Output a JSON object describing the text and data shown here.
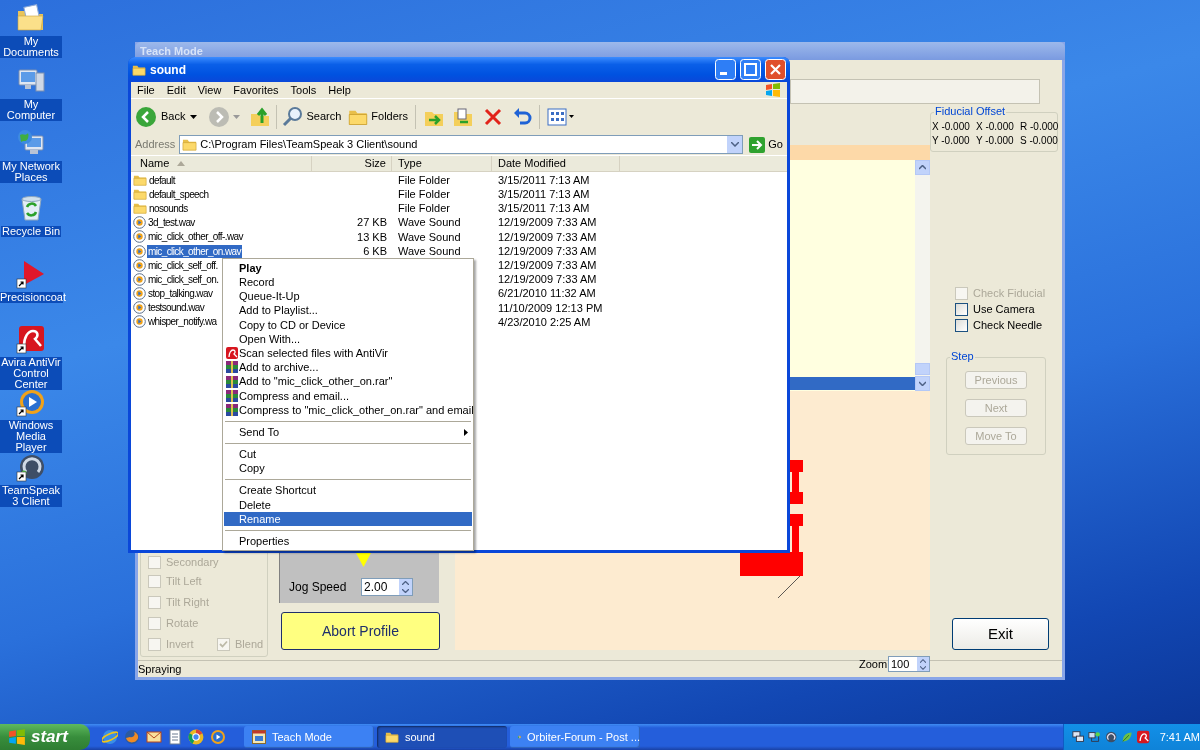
{
  "desktop_icons": [
    {
      "label": "My Documents",
      "kind": "documents",
      "shortcut": false
    },
    {
      "label": "My Computer",
      "kind": "computer",
      "shortcut": false
    },
    {
      "label": "My Network Places",
      "kind": "network",
      "shortcut": false
    },
    {
      "label": "Recycle Bin",
      "kind": "recycle",
      "shortcut": false
    },
    {
      "label": "Precisioncoat",
      "kind": "triangle",
      "shortcut": true
    },
    {
      "label": "Avira AntiVir Control Center",
      "kind": "umbrella",
      "shortcut": true
    },
    {
      "label": "Windows Media Player",
      "kind": "media",
      "shortcut": true
    },
    {
      "label": "TeamSpeak 3 Client",
      "kind": "headset",
      "shortcut": true
    }
  ],
  "teach_mode": {
    "title": "Teach Mode",
    "fiducial_offset": {
      "title": "Fiducial Offset",
      "rows": [
        [
          "X -0.000",
          "X -0.000",
          "R -0.000"
        ],
        [
          "Y -0.000",
          "Y -0.000",
          "S -0.000"
        ]
      ]
    },
    "program_list": {
      "rows": [
        {
          "selected": true
        }
      ]
    },
    "options": [
      {
        "label": "Check Fiducial",
        "checked": false,
        "disabled": true
      },
      {
        "label": "Use Camera",
        "checked": false,
        "disabled": false
      },
      {
        "label": "Check Needle",
        "checked": false,
        "disabled": false
      }
    ],
    "step": {
      "title": "Step",
      "buttons": [
        {
          "label": "Previous",
          "disabled": true
        },
        {
          "label": "Next",
          "disabled": true
        },
        {
          "label": "Move To",
          "disabled": true
        }
      ]
    },
    "exit_button": "Exit",
    "motion_options": [
      {
        "label": "Secondary",
        "checked": false,
        "disabled": true
      },
      {
        "label": "Tilt Left",
        "checked": false,
        "disabled": true
      },
      {
        "label": "Tilt Right",
        "checked": false,
        "disabled": true
      },
      {
        "label": "Rotate",
        "checked": false,
        "disabled": true
      },
      {
        "label": "Invert",
        "checked": false,
        "disabled": true
      },
      {
        "label": "Blend",
        "checked": true,
        "disabled": true
      }
    ],
    "jog_speed": {
      "label": "Jog Speed",
      "value": "2.00"
    },
    "abort_button": "Abort Profile",
    "status": "Spraying",
    "zoom": {
      "label": "Zoom",
      "value": "100"
    }
  },
  "explorer": {
    "title": "sound",
    "menu": [
      "File",
      "Edit",
      "View",
      "Favorites",
      "Tools",
      "Help"
    ],
    "toolbar": {
      "back": "Back",
      "search": "Search",
      "folders": "Folders"
    },
    "address": {
      "label": "Address",
      "value": "C:\\Program Files\\TeamSpeak 3 Client\\sound",
      "go": "Go"
    },
    "columns": [
      {
        "label": "Name",
        "sorted": true
      },
      {
        "label": "Size",
        "sorted": false
      },
      {
        "label": "Type",
        "sorted": false
      },
      {
        "label": "Date Modified",
        "sorted": false
      }
    ],
    "files": [
      {
        "kind": "folder",
        "name": "default",
        "type": "File Folder",
        "date": "3/15/2011 7:13 AM",
        "selected": false
      },
      {
        "kind": "folder",
        "name": "default_speech",
        "type": "File Folder",
        "date": "3/15/2011 7:13 AM",
        "selected": false
      },
      {
        "kind": "folder",
        "name": "nosounds",
        "type": "File Folder",
        "date": "3/15/2011 7:13 AM",
        "selected": false
      },
      {
        "kind": "sound",
        "name": "3d_test.wav",
        "size": "27 KB",
        "type": "Wave Sound",
        "date": "12/19/2009 7:33 AM",
        "selected": false
      },
      {
        "kind": "sound",
        "name": "mic_click_other_off-.wav",
        "size": "13 KB",
        "type": "Wave Sound",
        "date": "12/19/2009 7:33 AM",
        "selected": false
      },
      {
        "kind": "sound",
        "name": "mic_click_other_on.wav",
        "size": "6 KB",
        "type": "Wave Sound",
        "date": "12/19/2009 7:33 AM",
        "selected": true
      },
      {
        "kind": "sound",
        "name": "mic_click_self_off.",
        "date": "12/19/2009 7:33 AM",
        "selected": false
      },
      {
        "kind": "sound",
        "name": "mic_click_self_on.",
        "date": "12/19/2009 7:33 AM",
        "selected": false
      },
      {
        "kind": "sound",
        "name": "stop_talking.wav",
        "date": "6/21/2010 11:32 AM",
        "selected": false
      },
      {
        "kind": "sound",
        "name": "testsound.wav",
        "date": "11/10/2009 12:13 PM",
        "selected": false
      },
      {
        "kind": "sound",
        "name": "whisper_notify.wa",
        "date": "4/23/2010 2:25 AM",
        "selected": false
      }
    ]
  },
  "context_menu": {
    "items": [
      {
        "kind": "command",
        "label": "Play",
        "default": true,
        "selected": false
      },
      {
        "kind": "command",
        "label": "Record",
        "default": false,
        "selected": false
      },
      {
        "kind": "command",
        "label": "Queue-It-Up",
        "default": false,
        "selected": false
      },
      {
        "kind": "command",
        "label": "Add to Playlist...",
        "default": false,
        "selected": false
      },
      {
        "kind": "command",
        "label": "Copy to CD or Device",
        "default": false,
        "selected": false
      },
      {
        "kind": "command",
        "label": "Open With...",
        "default": false,
        "selected": false
      },
      {
        "kind": "antivir",
        "label": "Scan selected files with AntiVir",
        "default": false,
        "selected": false
      },
      {
        "kind": "archive",
        "label": "Add to archive...",
        "default": false,
        "selected": false
      },
      {
        "kind": "archive",
        "label": "Add to \"mic_click_other_on.rar\"",
        "default": false,
        "selected": false
      },
      {
        "kind": "archive",
        "label": "Compress and email...",
        "default": false,
        "selected": false
      },
      {
        "kind": "archive",
        "label": "Compress to \"mic_click_other_on.rar\" and email",
        "default": false,
        "selected": false
      },
      {
        "kind": "separator"
      },
      {
        "kind": "submenu",
        "label": "Send To",
        "default": false,
        "selected": false
      },
      {
        "kind": "separator"
      },
      {
        "kind": "command",
        "label": "Cut",
        "default": false,
        "selected": false
      },
      {
        "kind": "command",
        "label": "Copy",
        "default": false,
        "selected": false
      },
      {
        "kind": "separator"
      },
      {
        "kind": "command",
        "label": "Create Shortcut",
        "default": false,
        "selected": false
      },
      {
        "kind": "command",
        "label": "Delete",
        "default": false,
        "selected": false
      },
      {
        "kind": "command",
        "label": "Rename",
        "default": false,
        "selected": true
      },
      {
        "kind": "separator"
      },
      {
        "kind": "command",
        "label": "Properties",
        "default": false,
        "selected": false
      }
    ]
  },
  "taskbar": {
    "start": "start",
    "tasks": [
      {
        "kind": "app",
        "label": "Teach Mode",
        "selected": false
      },
      {
        "kind": "folder",
        "label": "sound",
        "selected": true
      },
      {
        "kind": "browser",
        "label": "Orbiter-Forum - Post ...",
        "selected": false
      }
    ],
    "clock": "7:41 AM"
  }
}
